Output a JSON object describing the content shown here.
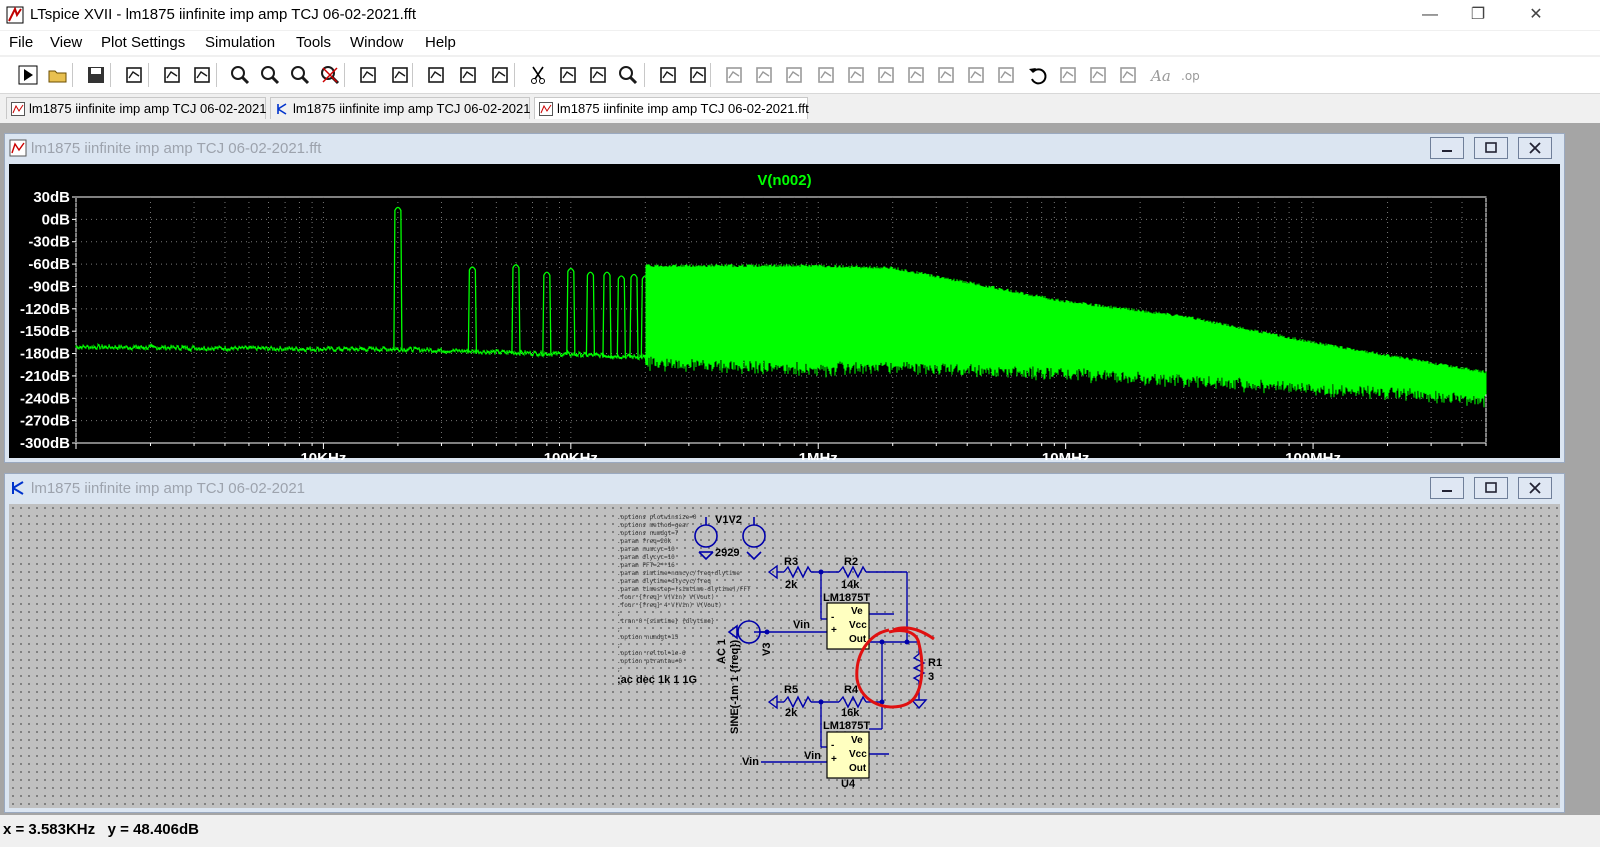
{
  "app": {
    "title": "LTspice XVII - lm1875 iinfinite imp amp TCJ 06-02-2021.fft"
  },
  "window_controls": {
    "minimize": "—",
    "restore": "❐",
    "close": "✕"
  },
  "menu": [
    "File",
    "View",
    "Plot Settings",
    "Simulation",
    "Tools",
    "Window",
    "Help"
  ],
  "toolbar": {
    "icons": [
      "run-icon",
      "open-icon",
      "save-icon",
      "control-panel-icon",
      "halt-icon",
      "pan-icon",
      "zoom-in-icon",
      "zoom-fit-icon",
      "zoom-out-icon",
      "zoom-cancel-icon",
      "autorange-icon",
      "mark-icon",
      "tile-icon",
      "cascade-icon",
      "tile-vertical-icon",
      "cut-icon",
      "copy-icon",
      "paste-icon",
      "find-icon",
      "print-setup-icon",
      "print-icon",
      "wire-icon",
      "ground-icon",
      "label-icon",
      "resistor-icon",
      "capacitor-icon",
      "inductor-icon",
      "diode-icon",
      "component-icon",
      "move-icon",
      "drag-icon",
      "undo-icon",
      "redo-icon",
      "rotate-icon",
      "mirror-icon",
      "text-icon",
      "spice-directive-icon"
    ]
  },
  "tabs": [
    {
      "label": "lm1875 iinfinite imp amp TCJ 06-02-2021",
      "kind": "waveform",
      "active": false
    },
    {
      "label": "lm1875 iinfinite imp amp TCJ 06-02-2021",
      "kind": "schematic",
      "active": false
    },
    {
      "label": "lm1875 iinfinite imp amp TCJ 06-02-2021.fft",
      "kind": "waveform",
      "active": true
    }
  ],
  "plot_window": {
    "title": "lm1875 iinfinite imp amp TCJ 06-02-2021.fft"
  },
  "schematic_window": {
    "title": "lm1875 iinfinite imp amp TCJ 06-02-2021"
  },
  "chart_data": {
    "type": "line",
    "title": "V(n002)",
    "x_scale": "log",
    "xlim": [
      1000,
      500000000
    ],
    "ylim": [
      -300,
      30
    ],
    "x_ticks": [
      "10KHz",
      "100KHz",
      "1MHz",
      "10MHz",
      "100MHz"
    ],
    "y_ticks": [
      "30dB",
      "0dB",
      "-30dB",
      "-60dB",
      "-90dB",
      "-120dB",
      "-150dB",
      "-180dB",
      "-210dB",
      "-240dB",
      "-270dB",
      "-300dB"
    ],
    "grid": true,
    "series": [
      {
        "name": "V(n002)",
        "color": "#00ff00",
        "noise_floor": [
          [
            1000,
            -172
          ],
          [
            10000,
            -175
          ],
          [
            20000,
            -175
          ],
          [
            100000,
            -182
          ],
          [
            1000000,
            -195
          ],
          [
            2000000,
            -190
          ],
          [
            10000000,
            -200
          ],
          [
            100000000,
            -220
          ],
          [
            500000000,
            -235
          ]
        ],
        "envelope_top": [
          [
            200000,
            -62
          ],
          [
            1000000,
            -62
          ],
          [
            2000000,
            -65
          ],
          [
            10000000,
            -110
          ],
          [
            30000000,
            -130
          ],
          [
            100000000,
            -165
          ],
          [
            500000000,
            -205
          ]
        ],
        "harmonics": [
          [
            20000,
            12
          ],
          [
            40000,
            -68
          ],
          [
            60000,
            -65
          ],
          [
            80000,
            -75
          ],
          [
            100000,
            -70
          ],
          [
            120000,
            -75
          ],
          [
            140000,
            -75
          ],
          [
            160000,
            -80
          ],
          [
            180000,
            -78
          ],
          [
            200000,
            -80
          ]
        ]
      }
    ]
  },
  "schematic": {
    "directives": [
      ".options plotwinsize=0",
      ".options method=gear",
      ".options numdgt=7",
      ".param freq=20k",
      ".param numcyc=10",
      ".param dlycyc=10",
      ".param FFT=2**16",
      ".param simtime=numcyc/freq+dlytime",
      ".param dlytime=dlycyc/freq",
      ".param timestep=(simtime-dlytime)/FFT",
      ".four {freq} V(Vin) V(Vout)",
      ".four {freq} 4 V(Vin) V(Vout)",
      ";",
      ".tran 0 {simtime} {dlytime}",
      ";",
      ".option numdgt=15",
      ";",
      ".option reltol=1e-6",
      ".option ptrantau=0",
      ";",
      ";ac dec 1k 1 1G"
    ],
    "ac_directive": ";ac dec 1k 1 1G",
    "labels": {
      "v1v2": "V1V2",
      "v_value": "2929",
      "r3": "R3",
      "r3_val": "2k",
      "r2": "R2",
      "r2_val": "14k",
      "u_top": "LM1875T",
      "ve": "Ve",
      "vcc": "Vcc",
      "out": "Out",
      "vin_net": "Vin",
      "v3": "V3",
      "ac1": "AC 1",
      "sine": "SINE(-1m 1 {freq})",
      "r1": "R1",
      "r1_val": "3",
      "r5": "R5",
      "r5_val": "2k",
      "r4": "R4",
      "r4_val": "16k",
      "u_bot": "LM1875T",
      "u4": "U4",
      "vin_bot": "Vin",
      "vin_bot2": "Vin",
      "minus": "-",
      "plus": "+"
    }
  },
  "status": {
    "x": "x = 3.583KHz",
    "y": "y = 48.406dB"
  }
}
